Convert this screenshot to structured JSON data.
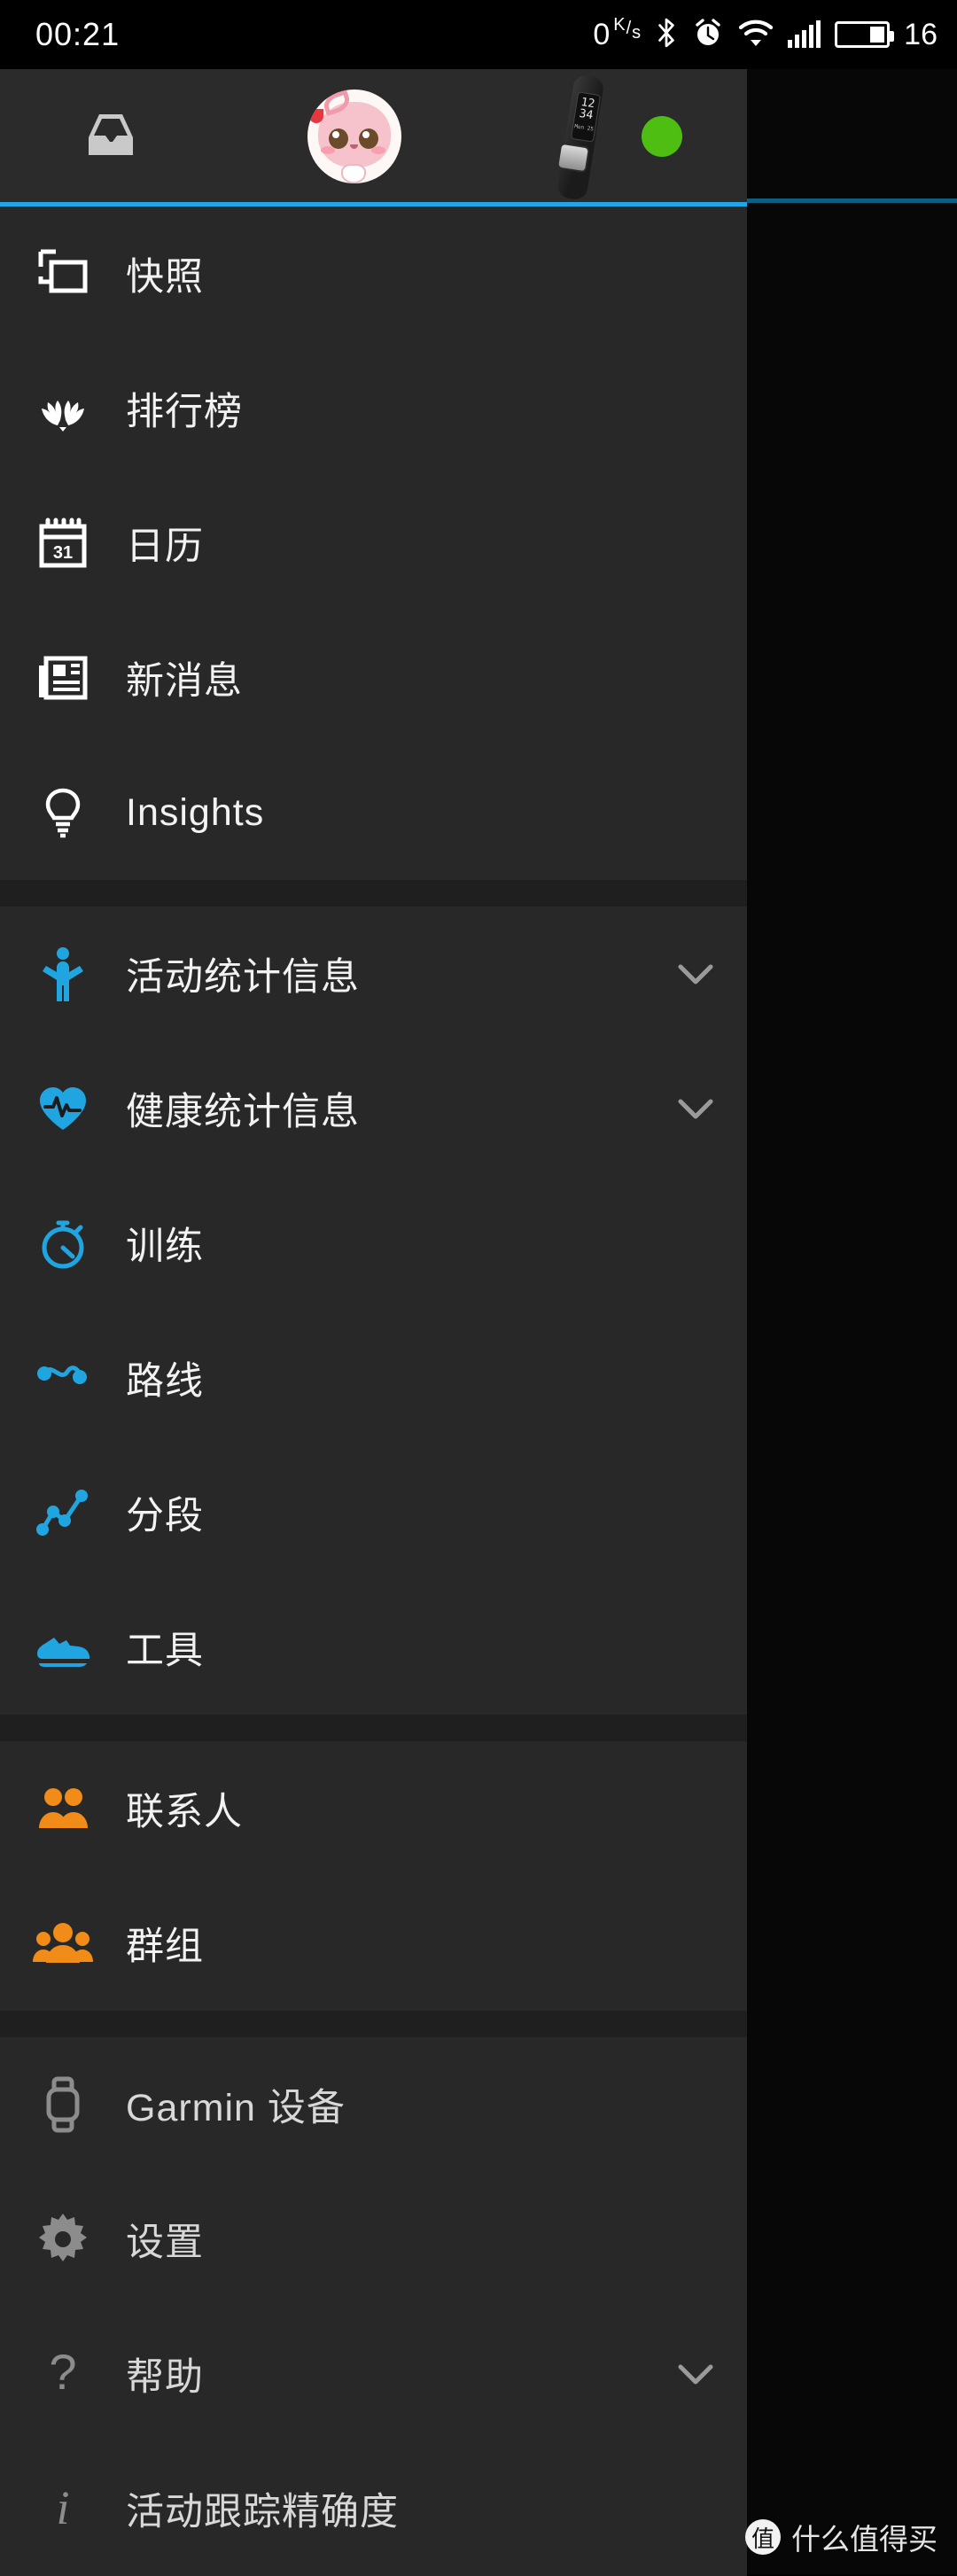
{
  "status_bar": {
    "time": "00:21",
    "net_speed": "0",
    "net_speed_unit_top": "K",
    "net_speed_unit_bottom": "s",
    "icons": [
      "bluetooth-icon",
      "alarm-clock-icon",
      "wifi-icon",
      "signal-bars-icon",
      "battery-icon"
    ],
    "battery_level": "16"
  },
  "header": {
    "inbox_icon": "inbox-icon",
    "avatar": "user-avatar",
    "device_icon": "garmin-band-device",
    "device_screen_line1": "12",
    "device_screen_line2": "34",
    "device_screen_line3": "Mon 25",
    "connection_status": "connected",
    "accent_color": "#1fa7e8"
  },
  "drawer": {
    "groups": [
      {
        "items": [
          {
            "icon": "snapshot-icon",
            "label": "快照",
            "color": "#ffffff",
            "expandable": false
          },
          {
            "icon": "leaderboard-laurel-icon",
            "label": "排行榜",
            "color": "#ffffff",
            "expandable": false
          },
          {
            "icon": "calendar-icon",
            "label": "日历",
            "color": "#ffffff",
            "expandable": false
          },
          {
            "icon": "news-icon",
            "label": "新消息",
            "color": "#ffffff",
            "expandable": false
          },
          {
            "icon": "lightbulb-icon",
            "label": "Insights",
            "color": "#ffffff",
            "expandable": false
          }
        ]
      },
      {
        "items": [
          {
            "icon": "activity-person-icon",
            "label": "活动统计信息",
            "color": "#20a5e0",
            "expandable": true
          },
          {
            "icon": "health-heart-icon",
            "label": "健康统计信息",
            "color": "#20a5e0",
            "expandable": true
          },
          {
            "icon": "stopwatch-icon",
            "label": "训练",
            "color": "#20a5e0",
            "expandable": false
          },
          {
            "icon": "route-icon",
            "label": "路线",
            "color": "#20a5e0",
            "expandable": false
          },
          {
            "icon": "segments-chart-icon",
            "label": "分段",
            "color": "#20a5e0",
            "expandable": false
          },
          {
            "icon": "running-shoe-icon",
            "label": "工具",
            "color": "#20a5e0",
            "expandable": false
          }
        ]
      },
      {
        "items": [
          {
            "icon": "contacts-people-icon",
            "label": "联系人",
            "color": "#f08c17",
            "expandable": false
          },
          {
            "icon": "groups-people-icon",
            "label": "群组",
            "color": "#f08c17",
            "expandable": false
          }
        ]
      },
      {
        "items": [
          {
            "icon": "watch-device-icon",
            "label": "Garmin 设备",
            "color": "#8c8c8c",
            "expandable": false
          },
          {
            "icon": "gear-icon",
            "label": "设置",
            "color": "#8c8c8c",
            "expandable": false
          },
          {
            "icon": "help-question-icon",
            "label": "帮助",
            "color": "#8c8c8c",
            "expandable": true
          },
          {
            "icon": "info-icon",
            "label": "活动跟踪精确度",
            "color": "#8c8c8c",
            "expandable": false
          }
        ]
      }
    ]
  },
  "watermark": {
    "logo_char": "值",
    "text": "什么值得买"
  }
}
